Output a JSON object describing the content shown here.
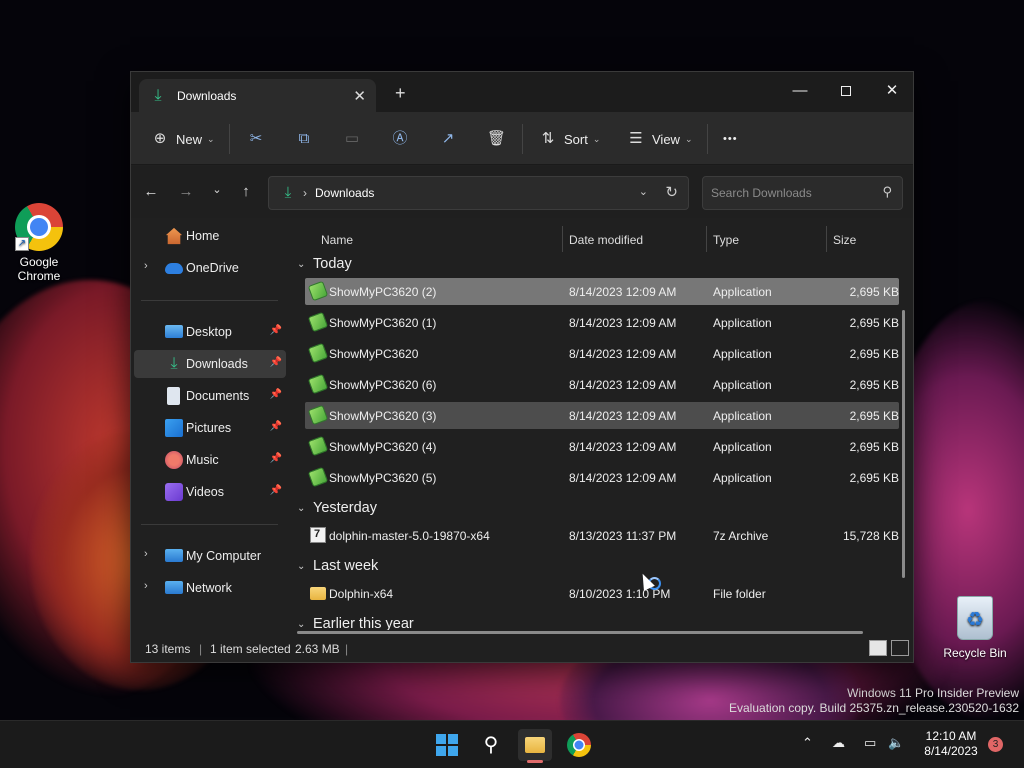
{
  "desktop": {
    "icons": [
      {
        "label_line1": "Google",
        "label_line2": "Chrome"
      },
      {
        "label": "Recycle Bin"
      }
    ],
    "watermark": {
      "line1": "Windows 11 Pro Insider Preview",
      "line2": "Evaluation copy. Build 25375.zn_release.230520-1632"
    }
  },
  "window": {
    "tab_title": "Downloads",
    "toolbar": {
      "new_label": "New",
      "sort_label": "Sort",
      "view_label": "View",
      "more_label": "•••"
    },
    "address": {
      "path": "Downloads",
      "search_placeholder": "Search Downloads"
    },
    "sidebar": {
      "items": [
        {
          "label": "Home",
          "icon": "home-icon"
        },
        {
          "label": "OneDrive",
          "icon": "cloud-icon"
        },
        {
          "label": "Desktop",
          "icon": "desktop-icon",
          "pinned": true
        },
        {
          "label": "Downloads",
          "icon": "download-icon",
          "pinned": true,
          "selected": true
        },
        {
          "label": "Documents",
          "icon": "document-icon",
          "pinned": true
        },
        {
          "label": "Pictures",
          "icon": "pictures-icon",
          "pinned": true
        },
        {
          "label": "Music",
          "icon": "music-icon",
          "pinned": true
        },
        {
          "label": "Videos",
          "icon": "videos-icon",
          "pinned": true
        },
        {
          "label": "My Computer",
          "icon": "computer-icon"
        },
        {
          "label": "Network",
          "icon": "network-icon"
        }
      ]
    },
    "columns": [
      "Name",
      "Date modified",
      "Type",
      "Size"
    ],
    "groups": [
      {
        "label": "Today",
        "rows": [
          {
            "name": "ShowMyPC3620 (2)",
            "date": "8/14/2023 12:09 AM",
            "type": "Application",
            "size": "2,695 KB"
          },
          {
            "name": "ShowMyPC3620 (1)",
            "date": "8/14/2023 12:09 AM",
            "type": "Application",
            "size": "2,695 KB"
          },
          {
            "name": "ShowMyPC3620",
            "date": "8/14/2023 12:09 AM",
            "type": "Application",
            "size": "2,695 KB"
          },
          {
            "name": "ShowMyPC3620 (6)",
            "date": "8/14/2023 12:09 AM",
            "type": "Application",
            "size": "2,695 KB"
          },
          {
            "name": "ShowMyPC3620 (3)",
            "date": "8/14/2023 12:09 AM",
            "type": "Application",
            "size": "2,695 KB"
          },
          {
            "name": "ShowMyPC3620 (4)",
            "date": "8/14/2023 12:09 AM",
            "type": "Application",
            "size": "2,695 KB"
          },
          {
            "name": "ShowMyPC3620 (5)",
            "date": "8/14/2023 12:09 AM",
            "type": "Application",
            "size": "2,695 KB"
          }
        ]
      },
      {
        "label": "Yesterday",
        "rows": [
          {
            "name": "dolphin-master-5.0-19870-x64",
            "date": "8/13/2023 11:37 PM",
            "type": "7z Archive",
            "size": "15,728 KB"
          }
        ]
      },
      {
        "label": "Last week",
        "rows": [
          {
            "name": "Dolphin-x64",
            "date": "8/10/2023 1:10 PM",
            "type": "File folder",
            "size": ""
          }
        ]
      },
      {
        "label": "Earlier this year",
        "rows": []
      }
    ],
    "status": {
      "items_count": "13 items",
      "selected": "1 item selected",
      "selected_size": "2.63 MB",
      "separator": "|"
    }
  },
  "taskbar": {
    "clock_time": "12:10 AM",
    "clock_date": "8/14/2023",
    "notification_count": "3"
  }
}
